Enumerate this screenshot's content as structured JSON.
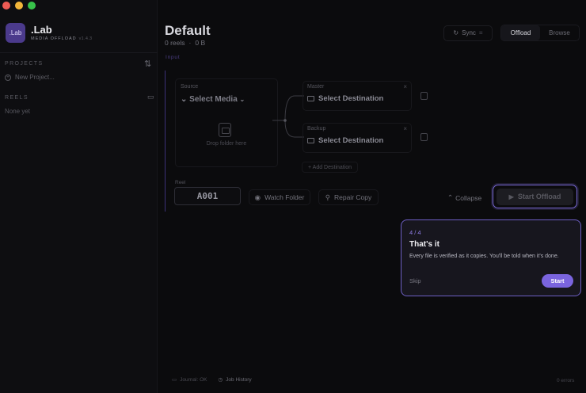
{
  "app": {
    "name": ".Lab",
    "logo_text": ".Lab",
    "subtitle": "MEDIA OFFLOAD",
    "version": "v1.4.3"
  },
  "sidebar": {
    "projects_label": "PROJECTS",
    "new_project_label": "New Project...",
    "reels_label": "REELS",
    "reels_empty": "None yet"
  },
  "header": {
    "title": "Default",
    "reels_count": "0 reels",
    "separator": "·",
    "size": "0 B",
    "sync_label": "Sync",
    "tabs": [
      {
        "label": "Offload",
        "active": true
      },
      {
        "label": "Browse",
        "active": false
      }
    ]
  },
  "input": {
    "section_label": "Input",
    "source_label": "Source",
    "select_media_label": "Select Media",
    "drop_text": "Drop folder here",
    "destinations": [
      {
        "label": "Master",
        "value": "Select Destination"
      },
      {
        "label": "Backup",
        "value": "Select Destination"
      }
    ],
    "add_destination_label": "+ Add Destination",
    "reel_label": "Reel",
    "reel_value": "A001",
    "watch_folder_label": "Watch Folder",
    "repair_copy_label": "Repair Copy",
    "collapse_label": "Collapse",
    "start_offload_label": "Start Offload"
  },
  "tour": {
    "step": "4 / 4",
    "title": "That's it",
    "body": "Every file is verified as it copies. You'll be told when it's done.",
    "skip_label": "Skip",
    "start_label": "Start"
  },
  "footer": {
    "journal_label": "Journal: OK",
    "job_history_label": "Job History",
    "errors_label": "0 errors"
  },
  "colors": {
    "accent": "#7a64de",
    "background": "#0b0b0d",
    "traffic_red": "#ee5b54",
    "traffic_yellow": "#f2b53a",
    "traffic_green": "#37c24a"
  },
  "icons": [
    "sort-icon",
    "folder-icon",
    "sync-icon",
    "chevron-down-icon",
    "drive-icon",
    "copy-icon",
    "eye-icon",
    "wrench-icon",
    "chevron-up-icon",
    "play-icon",
    "clock-icon",
    "journal-icon"
  ]
}
